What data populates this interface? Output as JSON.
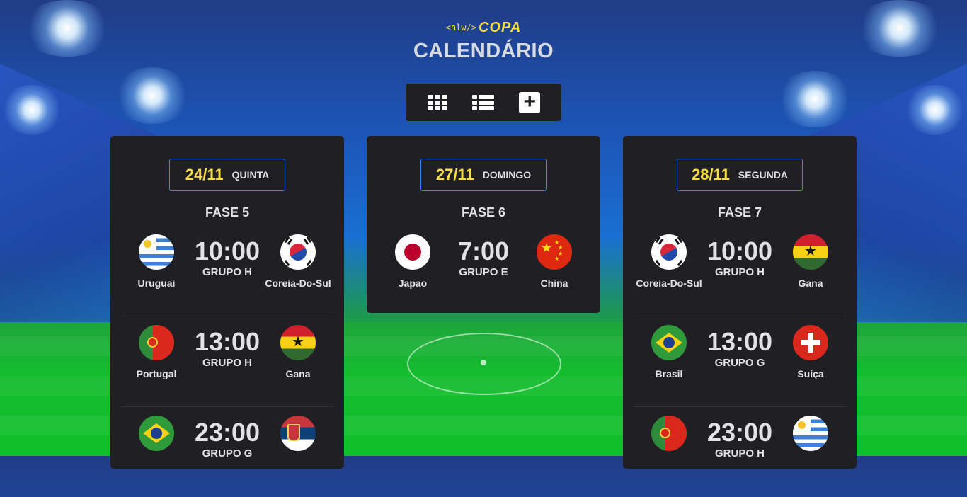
{
  "header": {
    "logo_tag": "<nlw/>",
    "logo_text": "COPA",
    "title": "CALENDÁRIO"
  },
  "toolbar": {
    "buttons": [
      "grid-view",
      "list-view",
      "add"
    ]
  },
  "days": [
    {
      "date": "24/11",
      "weekday": "QUINTA",
      "phase": "FASE 5",
      "matches": [
        {
          "home": "Uruguai",
          "away": "Coreia-Do-Sul",
          "time": "10:00",
          "group": "GRUPO H"
        },
        {
          "home": "Portugal",
          "away": "Gana",
          "time": "13:00",
          "group": "GRUPO H"
        },
        {
          "home": "",
          "away": "",
          "time": "23:00",
          "group": "GRUPO G"
        }
      ]
    },
    {
      "date": "27/11",
      "weekday": "DOMINGO",
      "phase": "FASE 6",
      "matches": [
        {
          "home": "Japao",
          "away": "China",
          "time": "7:00",
          "group": "GRUPO E"
        }
      ]
    },
    {
      "date": "28/11",
      "weekday": "SEGUNDA",
      "phase": "FASE 7",
      "matches": [
        {
          "home": "Coreia-Do-Sul",
          "away": "Gana",
          "time": "10:00",
          "group": "GRUPO H"
        },
        {
          "home": "Brasil",
          "away": "Suiça",
          "time": "13:00",
          "group": "GRUPO G"
        },
        {
          "home": "",
          "away": "",
          "time": "23:00",
          "group": "GRUPO H"
        }
      ]
    }
  ],
  "colors": {
    "accent": "#f7dd43",
    "card": "#202024",
    "border": "#3b82f6",
    "text": "#e1e1e6"
  }
}
